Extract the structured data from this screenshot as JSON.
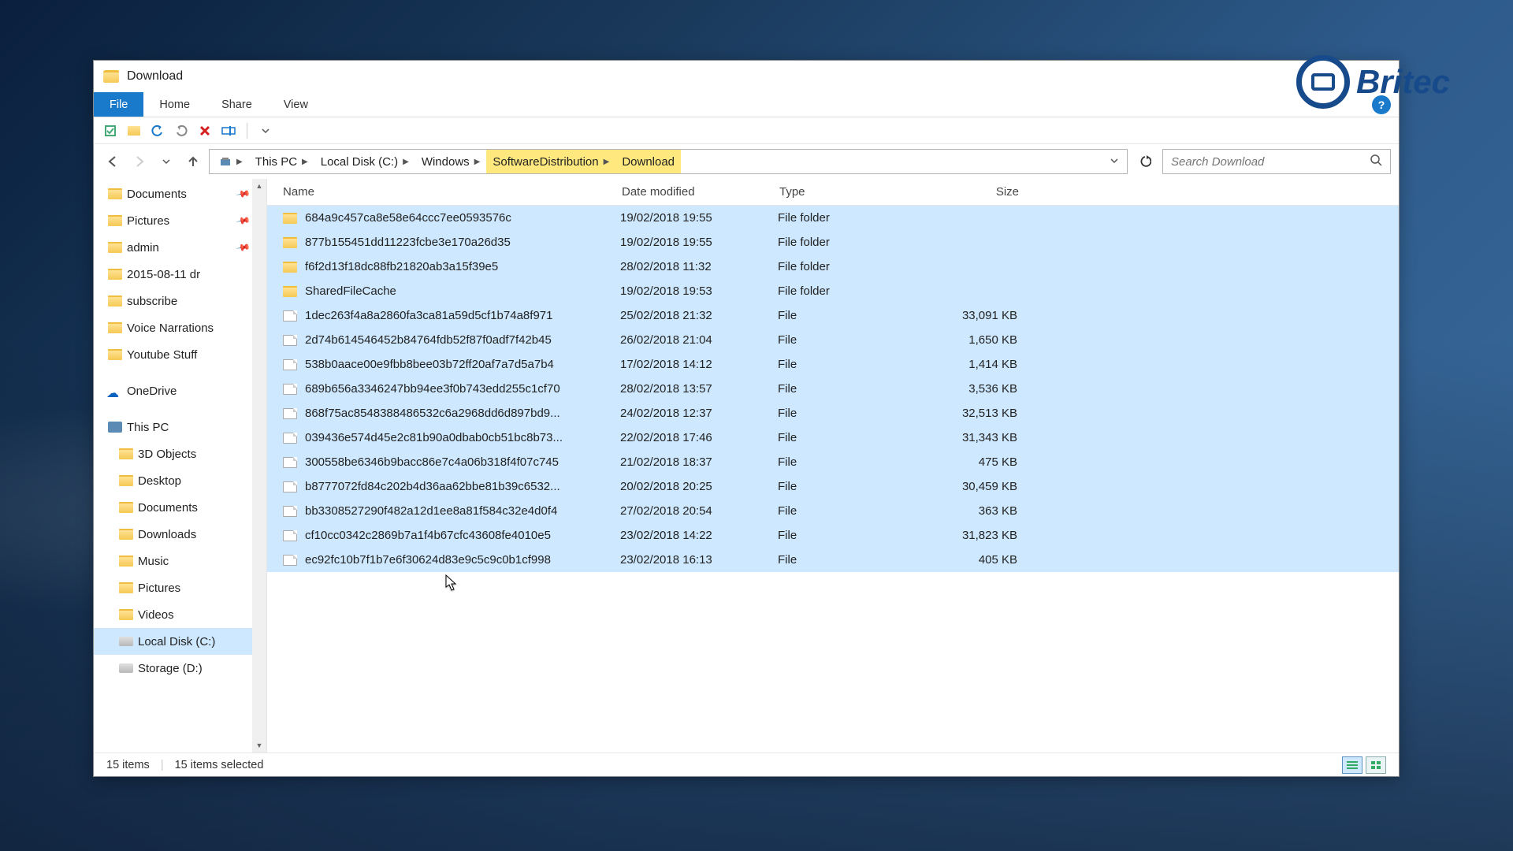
{
  "window": {
    "title": "Download"
  },
  "tabs": {
    "file": "File",
    "home": "Home",
    "share": "Share",
    "view": "View"
  },
  "breadcrumb": [
    "This PC",
    "Local Disk (C:)",
    "Windows",
    "SoftwareDistribution",
    "Download"
  ],
  "search": {
    "placeholder": "Search Download"
  },
  "sidebar": {
    "quick": [
      {
        "label": "Documents",
        "pinned": true
      },
      {
        "label": "Pictures",
        "pinned": true
      },
      {
        "label": "admin",
        "pinned": true
      },
      {
        "label": "2015-08-11 dr",
        "pinned": false
      },
      {
        "label": "subscribe",
        "pinned": false
      },
      {
        "label": "Voice Narrations",
        "pinned": false
      },
      {
        "label": "Youtube Stuff",
        "pinned": false
      }
    ],
    "onedrive": "OneDrive",
    "thispc": "This PC",
    "pc_children": [
      {
        "label": "3D Objects"
      },
      {
        "label": "Desktop"
      },
      {
        "label": "Documents"
      },
      {
        "label": "Downloads"
      },
      {
        "label": "Music"
      },
      {
        "label": "Pictures"
      },
      {
        "label": "Videos"
      },
      {
        "label": "Local Disk (C:)"
      },
      {
        "label": "Storage (D:)"
      }
    ]
  },
  "columns": {
    "name": "Name",
    "date": "Date modified",
    "type": "Type",
    "size": "Size"
  },
  "rows": [
    {
      "kind": "folder",
      "name": "684a9c457ca8e58e64ccc7ee0593576c",
      "date": "19/02/2018 19:55",
      "type": "File folder",
      "size": ""
    },
    {
      "kind": "folder",
      "name": "877b155451dd11223fcbe3e170a26d35",
      "date": "19/02/2018 19:55",
      "type": "File folder",
      "size": ""
    },
    {
      "kind": "folder",
      "name": "f6f2d13f18dc88fb21820ab3a15f39e5",
      "date": "28/02/2018 11:32",
      "type": "File folder",
      "size": ""
    },
    {
      "kind": "folder",
      "name": "SharedFileCache",
      "date": "19/02/2018 19:53",
      "type": "File folder",
      "size": ""
    },
    {
      "kind": "file",
      "name": "1dec263f4a8a2860fa3ca81a59d5cf1b74a8f971",
      "date": "25/02/2018 21:32",
      "type": "File",
      "size": "33,091 KB"
    },
    {
      "kind": "file",
      "name": "2d74b614546452b84764fdb52f87f0adf7f42b45",
      "date": "26/02/2018 21:04",
      "type": "File",
      "size": "1,650 KB"
    },
    {
      "kind": "file",
      "name": "538b0aace00e9fbb8bee03b72ff20af7a7d5a7b4",
      "date": "17/02/2018 14:12",
      "type": "File",
      "size": "1,414 KB"
    },
    {
      "kind": "file",
      "name": "689b656a3346247bb94ee3f0b743edd255c1cf70",
      "date": "28/02/2018 13:57",
      "type": "File",
      "size": "3,536 KB"
    },
    {
      "kind": "file",
      "name": "868f75ac8548388486532c6a2968dd6d897bd9...",
      "date": "24/02/2018 12:37",
      "type": "File",
      "size": "32,513 KB"
    },
    {
      "kind": "file",
      "name": "039436e574d45e2c81b90a0dbab0cb51bc8b73...",
      "date": "22/02/2018 17:46",
      "type": "File",
      "size": "31,343 KB"
    },
    {
      "kind": "file",
      "name": "300558be6346b9bacc86e7c4a06b318f4f07c745",
      "date": "21/02/2018 18:37",
      "type": "File",
      "size": "475 KB"
    },
    {
      "kind": "file",
      "name": "b8777072fd84c202b4d36aa62bbe81b39c6532...",
      "date": "20/02/2018 20:25",
      "type": "File",
      "size": "30,459 KB"
    },
    {
      "kind": "file",
      "name": "bb3308527290f482a12d1ee8a81f584c32e4d0f4",
      "date": "27/02/2018 20:54",
      "type": "File",
      "size": "363 KB"
    },
    {
      "kind": "file",
      "name": "cf10cc0342c2869b7a1f4b67cfc43608fe4010e5",
      "date": "23/02/2018 14:22",
      "type": "File",
      "size": "31,823 KB"
    },
    {
      "kind": "file",
      "name": "ec92fc10b7f1b7e6f30624d83e9c5c9c0b1cf998",
      "date": "23/02/2018 16:13",
      "type": "File",
      "size": "405 KB"
    }
  ],
  "status": {
    "items": "15 items",
    "selected": "15 items selected"
  },
  "logo": "Britec"
}
